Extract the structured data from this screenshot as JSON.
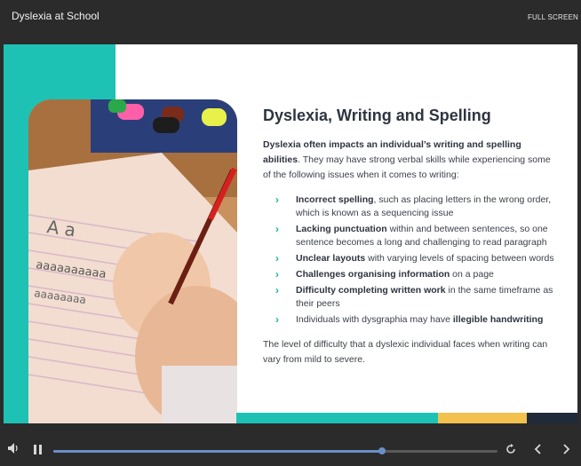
{
  "header": {
    "title": "Dyslexia at School",
    "fullscreen_label": "FULL SCREEN"
  },
  "slide": {
    "heading": "Dyslexia, Writing and Spelling",
    "intro_bold": "Dyslexia often impacts an individual’s writing and spelling abilities",
    "intro_rest": ". They may have strong verbal skills while experiencing some of the following issues when it comes to writing:",
    "items": [
      {
        "bold": "Incorrect spelling",
        "text": ", such as placing letters in the wrong order, which is known as a sequencing issue"
      },
      {
        "bold": "Lacking punctuation",
        "text": " within and between sentences, so one sentence becomes a long and challenging to read paragraph"
      },
      {
        "bold": "Unclear layouts",
        "text": " with varying levels of spacing between words"
      },
      {
        "bold": "Challenges organising information",
        "text": " on a page"
      },
      {
        "bold": "Difficulty completing written work",
        "text": " in the same timeframe as their peers"
      },
      {
        "pre": "Individuals with dysgraphia may have ",
        "bold": "illegible handwriting"
      }
    ],
    "outro": "The level of difficulty that a dyslexic individual faces when writing can vary from mild to severe.",
    "chevron": "›",
    "colors": {
      "teal": "#1ec2b4",
      "yellow": "#f2c14e",
      "navy": "#1e2a3a"
    }
  },
  "player": {
    "progress": 0.74,
    "icons": {
      "volume": "volume-icon",
      "pause": "pause-icon",
      "replay": "replay-icon",
      "prev": "chevron-left-icon",
      "next": "chevron-right-icon"
    }
  }
}
